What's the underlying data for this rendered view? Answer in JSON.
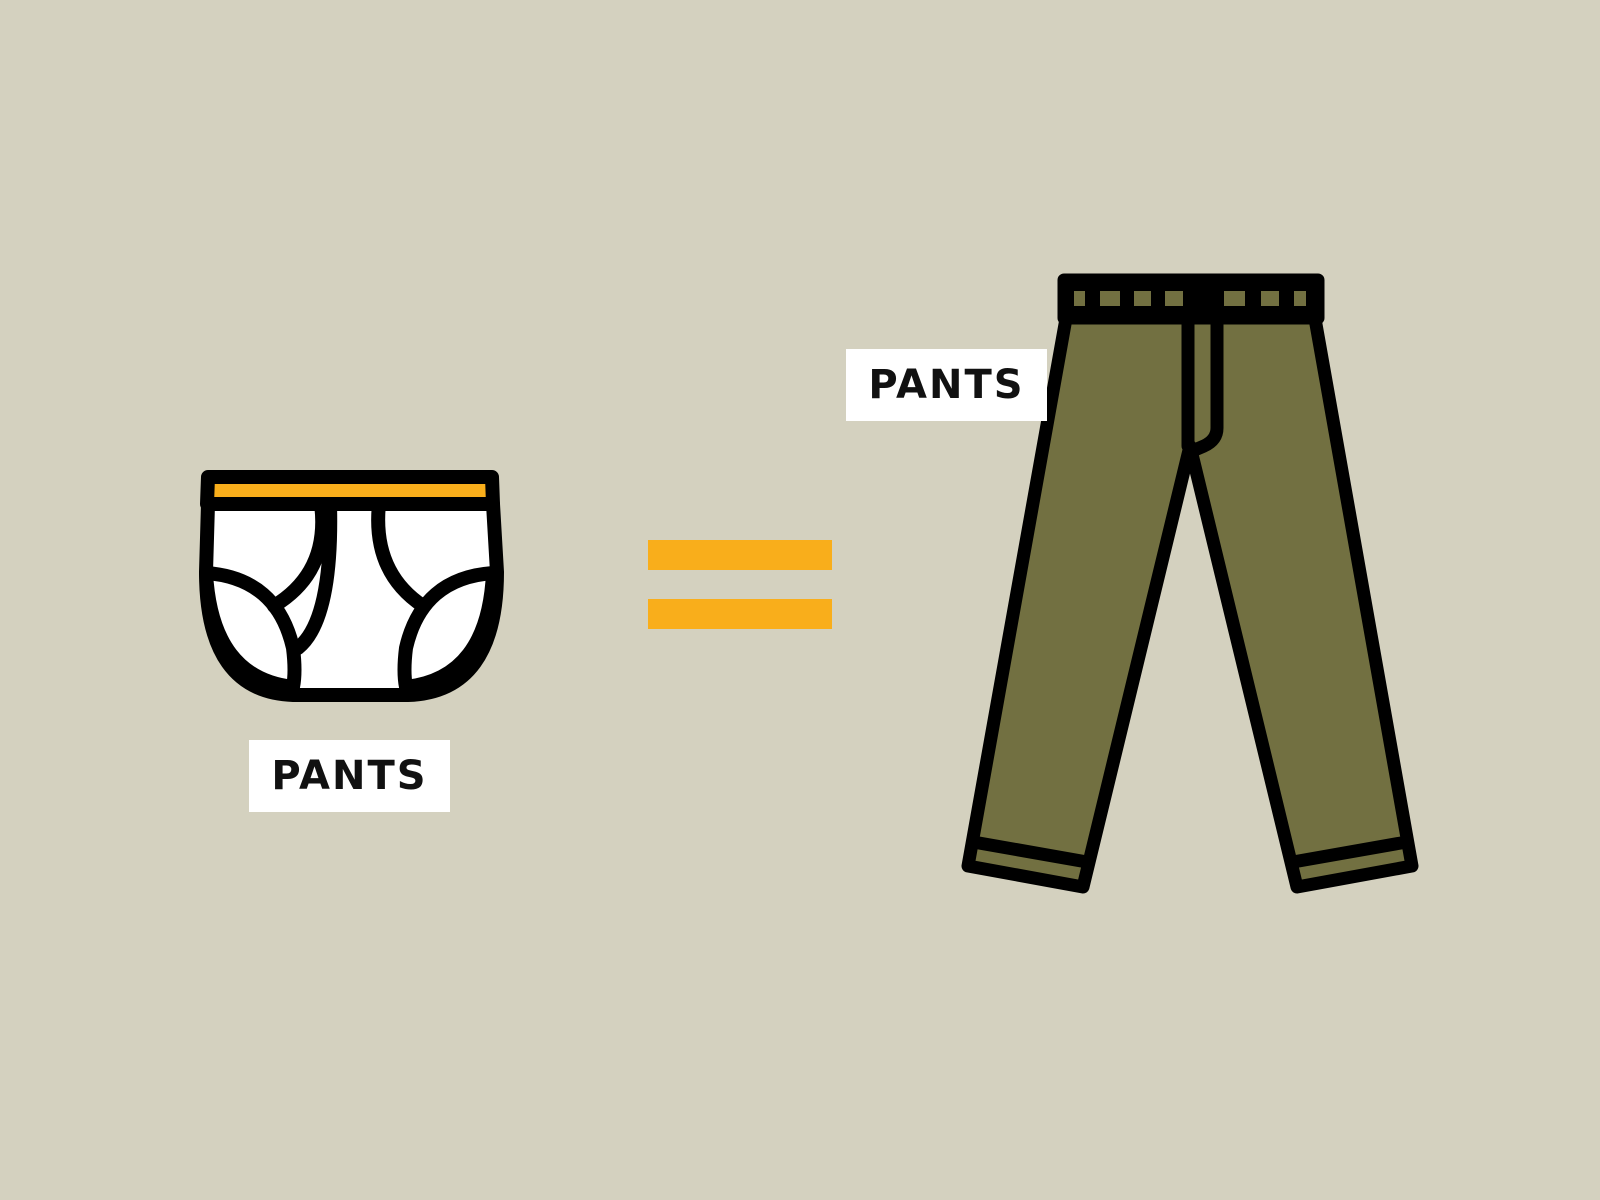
{
  "colors": {
    "background": "#d4d1bf",
    "accent": "#f9ae1b",
    "trousers": "#727041",
    "outline": "#000000",
    "briefs_body": "#ffffff"
  },
  "icons": {
    "left": "briefs-underwear-icon",
    "middle": "equals-sign-icon",
    "right": "trousers-icon"
  },
  "labels": {
    "briefs": "PANTS",
    "trousers": "PANTS"
  }
}
